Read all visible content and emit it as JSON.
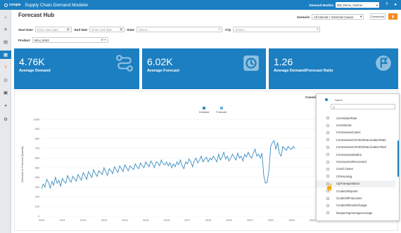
{
  "app": {
    "brand": "coupa",
    "title": "Supply Chain Demand Modeler",
    "demand_models_label": "Demand Models",
    "demand_model_value": "DM_Demo_Gartner"
  },
  "page": {
    "title": "Forecast Hub"
  },
  "scenario": {
    "label": "Scenario",
    "value": "All Internal + External Causal"
  },
  "buttons": {
    "download": "Download"
  },
  "filters": {
    "start_date": {
      "label": "Start Date",
      "placeholder": "Enter start date"
    },
    "end_date": {
      "label": "End date",
      "placeholder": "Enter end date"
    },
    "state": {
      "label": "State",
      "placeholder": "Select..."
    },
    "city": {
      "label": "City",
      "placeholder": "Select..."
    },
    "product": {
      "label": "Product",
      "value": "SKU_8442"
    }
  },
  "cards": [
    {
      "value": "4.76K",
      "label": "Average Demand",
      "icon": "route-icon"
    },
    {
      "value": "6.02K",
      "label": "Average Forecast",
      "icon": "clock-icon"
    },
    {
      "value": "1.26",
      "label": "Average Demand/Forecast Ratio",
      "icon": "flag-icon"
    }
  ],
  "colors": {
    "primary": "#1c7fc1",
    "accent": "#f5891e",
    "demand_line": "#3a8cc2",
    "forecast_swatch": "#6fb0dc"
  },
  "causals": {
    "label": "Causals",
    "value": "CpiTransportation",
    "header": "Name",
    "search_placeholder": "Q",
    "items": [
      {
        "label": "CorrelationRate",
        "checked": false
      },
      {
        "label": "CoreStocks",
        "checked": false
      },
      {
        "label": "CoronavirusCases",
        "checked": false
      },
      {
        "label": "CoronavirusCOVID19VaccinationRate",
        "checked": false
      },
      {
        "label": "CoronavirusCOVID19VaccinationTotal",
        "checked": false
      },
      {
        "label": "CoronavirusDeaths",
        "checked": false
      },
      {
        "label": "CoronavirusRecovered",
        "checked": false
      },
      {
        "label": "Covid Cases",
        "checked": false
      },
      {
        "label": "CPIHousing",
        "checked": false
      },
      {
        "label": "CpiTransportation",
        "checked": true
      },
      {
        "label": "CrudeOilImports",
        "checked": false
      },
      {
        "label": "CrudeOilProduction",
        "checked": false
      },
      {
        "label": "CrudeOilStocksChange",
        "checked": false
      },
      {
        "label": "DeepeningAverageAverage",
        "checked": false
      }
    ]
  },
  "chart_data": {
    "type": "line",
    "ylabel": "Demand & Forecast Quantity",
    "legend": [
      "Demand",
      "Forecast"
    ],
    "xticks": [
      "2010",
      "2011",
      "2012",
      "2013",
      "2014",
      "2015",
      "2016",
      "2017",
      "2018",
      "2019",
      "2020",
      "2021",
      "2022",
      "2023"
    ],
    "ylim": [
      0,
      1000
    ],
    "yticks": [
      0,
      100,
      200,
      300,
      400,
      500,
      600,
      700,
      800,
      900,
      1000
    ],
    "series": [
      {
        "name": "Demand",
        "x_start": 2010,
        "step_years": 0.0833,
        "values": [
          280,
          330,
          300,
          380,
          350,
          290,
          360,
          320,
          400,
          340,
          370,
          310,
          390,
          360,
          340,
          420,
          380,
          350,
          410,
          390,
          360,
          430,
          400,
          370,
          450,
          420,
          380,
          460,
          430,
          400,
          480,
          440,
          410,
          470,
          450,
          430,
          500,
          460,
          420,
          490,
          470,
          440,
          510,
          480,
          450,
          520,
          490,
          460,
          530,
          500,
          470,
          520,
          500,
          480,
          540,
          510,
          490,
          550,
          520,
          500,
          560,
          530,
          510,
          570,
          540,
          500,
          560,
          550,
          520,
          580,
          540,
          530,
          560,
          520,
          550,
          500,
          540,
          510,
          560,
          530,
          580,
          520,
          490,
          560,
          540,
          590,
          560,
          510,
          570,
          600,
          550,
          580,
          620,
          560,
          590,
          610,
          560,
          600,
          580,
          620,
          590,
          560,
          640,
          580,
          610,
          660,
          590,
          620,
          570,
          600,
          640,
          610,
          580,
          650,
          600,
          620,
          570,
          640,
          610,
          660,
          620,
          600,
          650,
          690,
          620,
          640,
          600,
          650,
          420,
          340,
          350,
          480,
          720,
          760,
          780,
          690,
          760,
          650,
          620,
          720,
          700,
          680,
          720,
          700,
          690,
          720,
          700
        ]
      }
    ]
  }
}
